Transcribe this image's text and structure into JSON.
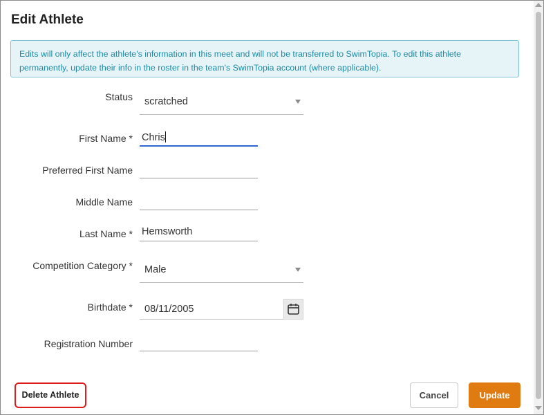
{
  "dialog": {
    "title": "Edit Athlete",
    "info_message": "Edits will only affect the athlete's information in this meet and will not be transferred to SwimTopia. To edit this athlete permanently, update their info in the roster in the team's SwimTopia account (where applicable)."
  },
  "form": {
    "status": {
      "label": "Status",
      "value": "scratched"
    },
    "first_name": {
      "label": "First Name *",
      "value": "Chris"
    },
    "preferred_first_name": {
      "label": "Preferred First Name",
      "value": ""
    },
    "middle_name": {
      "label": "Middle Name",
      "value": ""
    },
    "last_name": {
      "label": "Last Name *",
      "value": "Hemsworth"
    },
    "competition_category": {
      "label": "Competition Category *",
      "value": "Male"
    },
    "birthdate": {
      "label": "Birthdate *",
      "value": "08/11/2005"
    },
    "registration_number": {
      "label": "Registration Number",
      "value": ""
    }
  },
  "buttons": {
    "delete": "Delete Athlete",
    "cancel": "Cancel",
    "update": "Update"
  },
  "colors": {
    "accent": "#e07b12",
    "info_bg": "#e6f4f7",
    "info_text": "#1f8aa3",
    "focus": "#3366cc",
    "highlight": "#e01b1b"
  },
  "icons": {
    "calendar": "calendar-icon",
    "dropdown": "chevron-down-icon"
  }
}
